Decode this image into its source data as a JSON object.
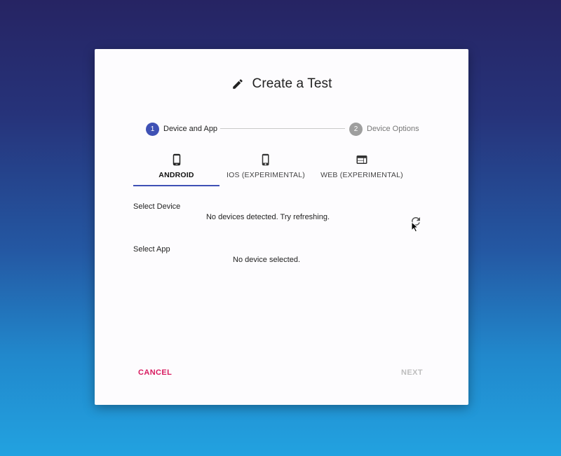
{
  "dialog": {
    "title": "Create a Test",
    "title_icon": "pencil-icon"
  },
  "stepper": {
    "steps": [
      {
        "number": "1",
        "label": "Device and App",
        "state": "active",
        "color": "#3f51b5"
      },
      {
        "number": "2",
        "label": "Device Options",
        "state": "inactive",
        "color": "#9e9e9e"
      }
    ]
  },
  "tabs": [
    {
      "label": "ANDROID",
      "icon": "smartphone-icon",
      "selected": true
    },
    {
      "label": "IOS (EXPERIMENTAL)",
      "icon": "iphone-icon",
      "selected": false
    },
    {
      "label": "WEB (EXPERIMENTAL)",
      "icon": "web-browser-icon",
      "selected": false
    }
  ],
  "device": {
    "label": "Select Device",
    "message": "No devices detected. Try refreshing.",
    "refresh_icon": "refresh-icon"
  },
  "app": {
    "label": "Select App",
    "message": "No device selected."
  },
  "actions": {
    "cancel_label": "CANCEL",
    "next_label": "NEXT"
  },
  "colors": {
    "accent": "#3f51b5",
    "cancel": "#d81b60",
    "disabled": "#bdbdbd"
  }
}
